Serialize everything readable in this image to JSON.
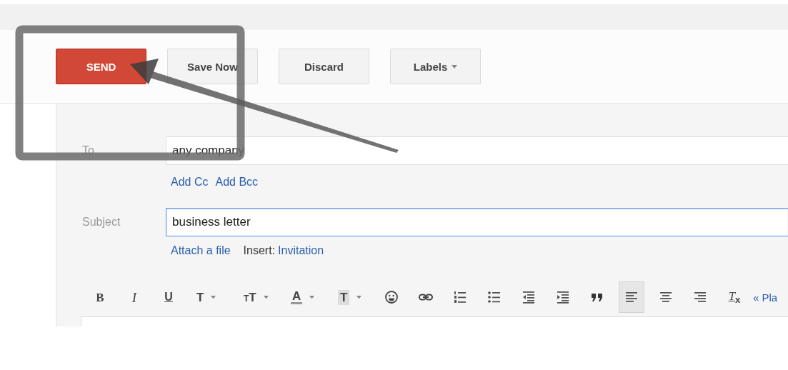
{
  "actions": [
    {
      "kind": "primary",
      "label": "SEND"
    },
    {
      "kind": "plain",
      "label": "Save Now"
    },
    {
      "kind": "plain",
      "label": "Discard"
    },
    {
      "kind": "menu",
      "label": "Labels"
    }
  ],
  "compose": {
    "to": {
      "label": "To",
      "value": "any company",
      "links": [
        "Add Cc",
        "Add Bcc"
      ]
    },
    "subject": {
      "label": "Subject",
      "value": "business letter",
      "focused": true
    },
    "attach": {
      "link": "Attach a file",
      "insert_label": "Insert:",
      "insert_link": "Invitation"
    }
  },
  "format_toolbar": [
    {
      "kind": "bold",
      "text": "B",
      "selected": false
    },
    {
      "kind": "italic",
      "text": "I",
      "selected": false
    },
    {
      "kind": "underline",
      "text": "U",
      "selected": false
    },
    {
      "kind": "font",
      "text": "T",
      "selected": false
    },
    {
      "kind": "size",
      "text": "$_{T}$T",
      "selected": false
    },
    {
      "kind": "color",
      "text": "A",
      "selected": false
    },
    {
      "kind": "highlight",
      "text": "T",
      "selected": false
    },
    {
      "kind": "emoji",
      "selected": false
    },
    {
      "kind": "link",
      "selected": false
    },
    {
      "kind": "numbered-list",
      "selected": false
    },
    {
      "kind": "bulleted-list",
      "selected": false
    },
    {
      "kind": "outdent",
      "selected": false
    },
    {
      "kind": "indent",
      "selected": false
    },
    {
      "kind": "quote",
      "selected": false
    },
    {
      "kind": "align-left",
      "selected": true
    },
    {
      "kind": "align-center",
      "selected": false
    },
    {
      "kind": "align-right",
      "selected": false
    },
    {
      "kind": "clear-format",
      "text": "T$_{x}$",
      "selected": false
    },
    {
      "kind": "plain-text",
      "text": "« Pla"
    }
  ]
}
